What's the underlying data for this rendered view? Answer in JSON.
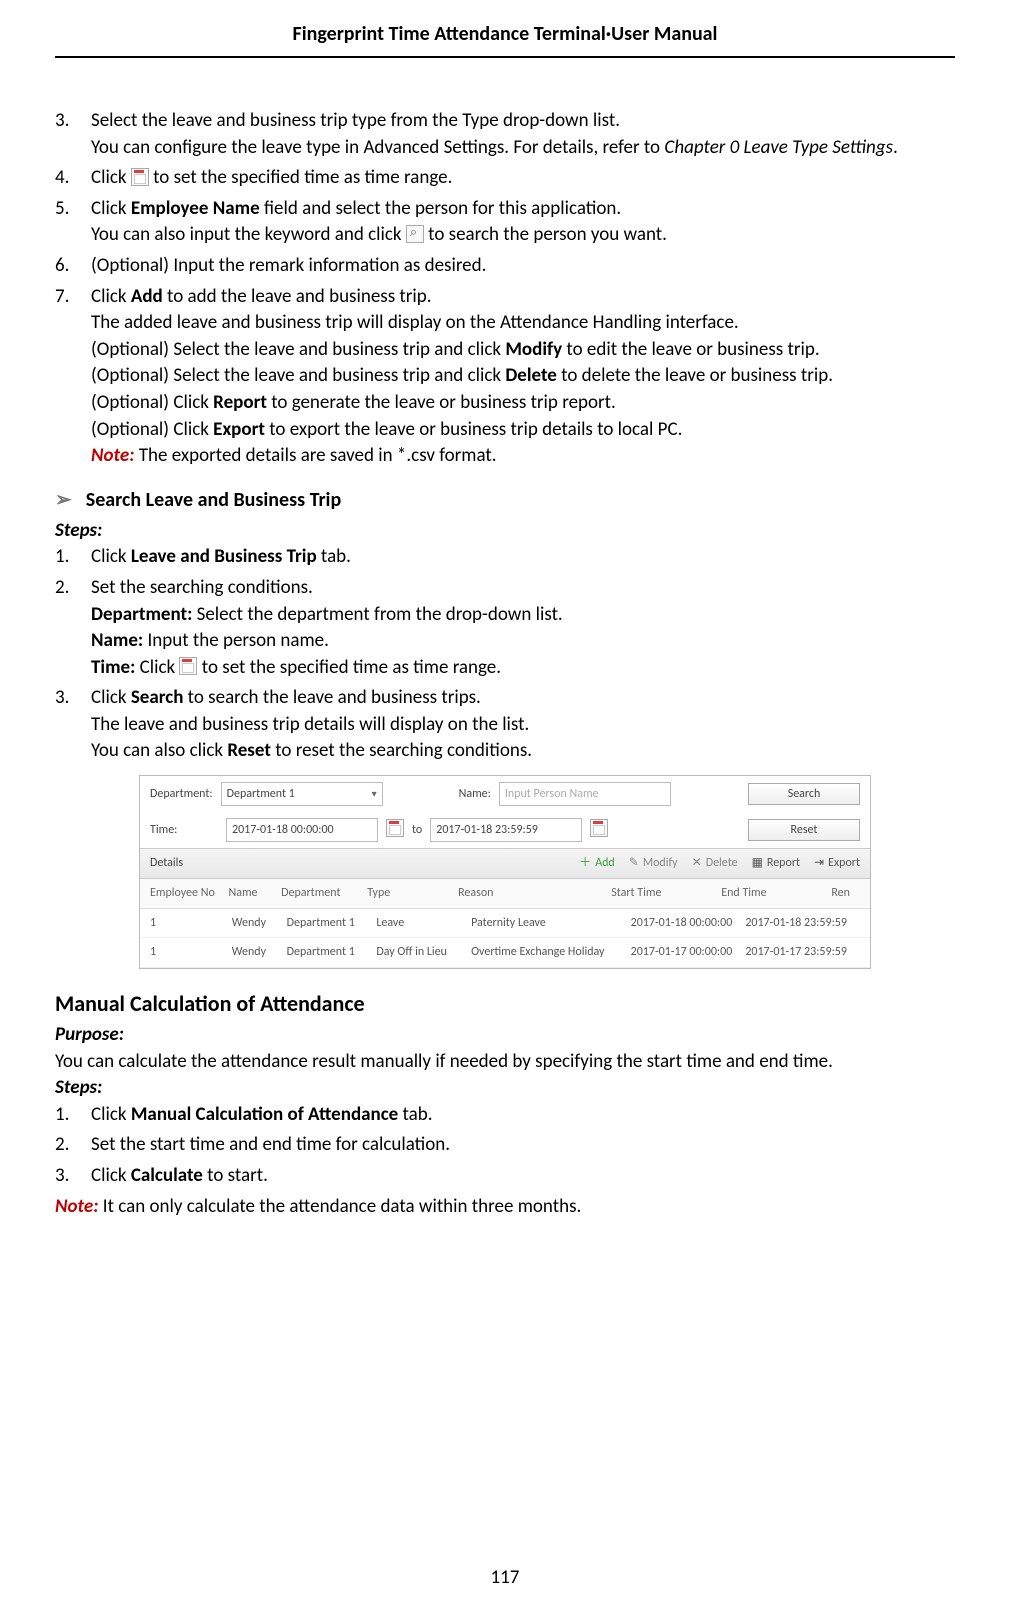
{
  "header": {
    "left": "Fingerprint Time Attendance Terminal",
    "sep": "·",
    "right": "User Manual"
  },
  "page_number": "117",
  "s3": {
    "intro": "Select the leave and business trip type from the Type drop-down list.",
    "l2a": "You can configure the leave type in Advanced Settings. For details, refer to ",
    "l2b": "Chapter 0 Leave Type Settings",
    "l2c": "."
  },
  "s4": {
    "a": "Click ",
    "b": " to set the specified time as time range."
  },
  "s5": {
    "a": "Click ",
    "b": "Employee Name",
    "c": " field and select the person for this application.",
    "d": "You can also input the keyword and click ",
    "e": " to search the person you want."
  },
  "s6": "(Optional) Input the remark information as desired.",
  "s7": {
    "a": "Click ",
    "b": "Add",
    "c": " to add the leave and business trip.",
    "d": "The added leave and business trip will display on the Attendance Handling interface.",
    "e1": "(Optional) Select the leave and business trip and click ",
    "e2": "Modify",
    "e3": " to edit the leave or business trip.",
    "f1": "(Optional) Select the leave and business trip and click ",
    "f2": "Delete",
    "f3": " to delete the leave or business trip.",
    "g1": "(Optional) Click ",
    "g2": "Report",
    "g3": " to generate the leave or business trip report.",
    "h1": "(Optional) Click ",
    "h2": "Export",
    "h3": " to export the leave or business trip details to local PC.",
    "note_label": "Note:",
    "note_text": " The exported details are saved in *.csv format."
  },
  "searchSection": {
    "title": "Search Leave and Business Trip",
    "steps_label": "Steps:",
    "s1": {
      "a": "Click ",
      "b": "Leave and Business Trip",
      "c": " tab."
    },
    "s2": {
      "a": "Set the searching conditions.",
      "dep_l": "Department:",
      "dep_t": " Select the department from the drop-down list.",
      "name_l": "Name:",
      "name_t": " Input the person name.",
      "time_l": "Time:",
      "time_t1": " Click ",
      "time_t2": " to set the specified time as time range."
    },
    "s3": {
      "a": "Click ",
      "b": "Search",
      "c": " to search the leave and business trips.",
      "d": "The leave and business trip details will display on the list.",
      "e1": "You can also click ",
      "e2": "Reset",
      "e3": " to reset the searching conditions."
    }
  },
  "screenshot": {
    "dept_label": "Department:",
    "dept_val": "Department 1",
    "name_label": "Name:",
    "name_placeholder": "Input Person Name",
    "search_btn": "Search",
    "time_label": "Time:",
    "time_from": "2017-01-18 00:00:00",
    "to": "to",
    "time_to": "2017-01-18 23:59:59",
    "reset_btn": "Reset",
    "details": "Details",
    "toolbar": {
      "add": "Add",
      "modify": "Modify",
      "delete": "Delete",
      "report": "Report",
      "export": "Export"
    },
    "cols": {
      "c1": "Employee No",
      "c2": "Name",
      "c3": "Department",
      "c4": "Type",
      "c5": "Reason",
      "c6": "Start Time",
      "c7": "End Time",
      "c8": "Ren"
    },
    "rows": [
      {
        "c1": "1",
        "c2": "Wendy",
        "c3": "Department 1",
        "c4": "Leave",
        "c5": "Paternity Leave",
        "c6": "2017-01-18 00:00:00",
        "c7": "2017-01-18 23:59:59"
      },
      {
        "c1": "1",
        "c2": "Wendy",
        "c3": "Department 1",
        "c4": "Day Off in Lieu",
        "c5": "Overtime Exchange Holiday",
        "c6": "2017-01-17 00:00:00",
        "c7": "2017-01-17 23:59:59"
      }
    ]
  },
  "manual": {
    "title": "Manual Calculation of Attendance",
    "purpose_l": "Purpose:",
    "purpose_t": "You can calculate the attendance result manually if needed by specifying the start time and end time.",
    "steps_l": "Steps:",
    "s1": {
      "a": "Click ",
      "b": "Manual Calculation of Attendance",
      "c": " tab."
    },
    "s2": "Set the start time and end time for calculation.",
    "s3": {
      "a": "Click ",
      "b": "Calculate",
      "c": " to start."
    },
    "note_l": "Note:",
    "note_t": " It can only calculate the attendance data within three months."
  }
}
